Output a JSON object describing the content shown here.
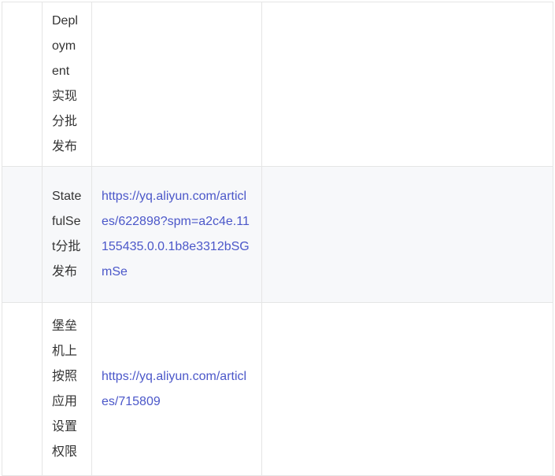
{
  "rows": [
    {
      "name": "Deployment实现分批发布",
      "link": ""
    },
    {
      "name": "StatefulSet分批发布",
      "link": "https://yq.aliyun.com/articles/622898?spm=a2c4e.11155435.0.0.1b8e3312bSGmSe"
    },
    {
      "name": "堡垒机上按照应用设置权限",
      "link": "https://yq.aliyun.com/articles/715809"
    }
  ]
}
